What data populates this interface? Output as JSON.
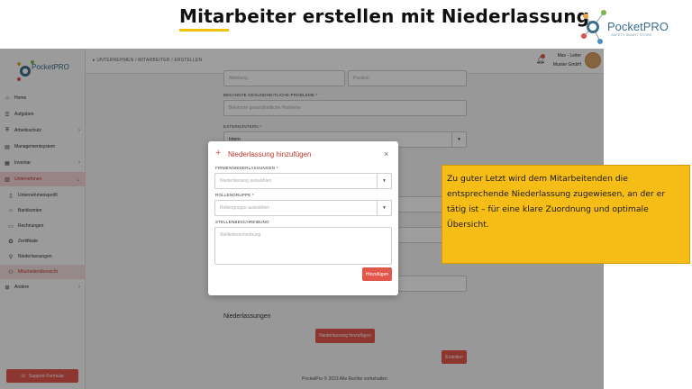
{
  "slide": {
    "title": "Mitarbeiter erstellen mit Niederlassung",
    "logo_text": "PocketPRO",
    "logo_sub": "SAFETY SMART STORE"
  },
  "sidebar": {
    "logo_text": "PocketPRO",
    "items": [
      {
        "label": "Home",
        "icon": "home-icon",
        "symbol": "⌂"
      },
      {
        "label": "Aufgaben",
        "icon": "tasks-icon",
        "symbol": "☰"
      },
      {
        "label": "Arbeitsschutz",
        "icon": "shield-icon",
        "symbol": "⛨",
        "chevron": "›"
      },
      {
        "label": "Managementsystem",
        "icon": "system-icon",
        "symbol": "▤"
      },
      {
        "label": "Inventar",
        "icon": "inventory-icon",
        "symbol": "▦",
        "chevron": "›"
      },
      {
        "label": "Unternehmen",
        "icon": "company-icon",
        "symbol": "▥",
        "chevron": "⌄"
      },
      {
        "label": "Unternehmensprofil",
        "icon": "profile-icon",
        "symbol": "▯"
      },
      {
        "label": "Bankkonten",
        "icon": "bank-icon",
        "symbol": "⌂"
      },
      {
        "label": "Rechnungen",
        "icon": "invoice-icon",
        "symbol": "▭"
      },
      {
        "label": "Zertifikate",
        "icon": "certificate-icon",
        "symbol": "✪"
      },
      {
        "label": "Niederlassungen",
        "icon": "branch-icon",
        "symbol": "⚲"
      },
      {
        "label": "Mitarbeiterübersicht",
        "icon": "employees-icon",
        "symbol": "⚇"
      },
      {
        "label": "Andere",
        "icon": "other-icon",
        "symbol": "⊞",
        "chevron": "›"
      }
    ],
    "support_button": "Support-Formular",
    "support_icon": "☏"
  },
  "topbar": {
    "breadcrumb": "UNTERNEHMEN / MITARBEITER / ERSTELLEN",
    "user_name": "Max - Leiter",
    "company": "Muster GmbH"
  },
  "form": {
    "abteilung_placeholder": "Abteilung",
    "position_placeholder": "Position",
    "health_label": "BEKANNTE GESUNDHEITLICHE PROBLEME *",
    "health_placeholder": "Bekannte gesundheitliche Probleme",
    "extern_label": "EXTERN/INTERN *",
    "extern_value": "Intern",
    "section_title": "Niederlassungen",
    "add_branch_button": "Niederlassung hinzufügen",
    "create_button": "Erstellen",
    "footer": "PocketPro © 2023 Alle Rechte vorbehalten"
  },
  "modal": {
    "title": "Niederlassung hinzufügen",
    "plus": "+",
    "close": "×",
    "branch_label": "FIRMENNIEDERLASSUNGEN *",
    "branch_placeholder": "Niederlassung auswählen",
    "role_label": "ROLLENGRUPPE *",
    "role_placeholder": "Rollengruppe auswählen",
    "desc_label": "STELLENBESCHREIBUNG",
    "desc_placeholder": "Stellenbeschreibung",
    "submit": "Hinzufügen"
  },
  "callout": {
    "text": "Zu guter Letzt wird dem Mitarbeitenden die entsprechende Niederlassung zugewiesen, an der er tätig ist – für eine klare Zuordnung und optimale Übersicht."
  },
  "colors": {
    "accent": "#e2574c",
    "callout_bg": "#f6bd16",
    "title_underline": "#f2c200"
  }
}
